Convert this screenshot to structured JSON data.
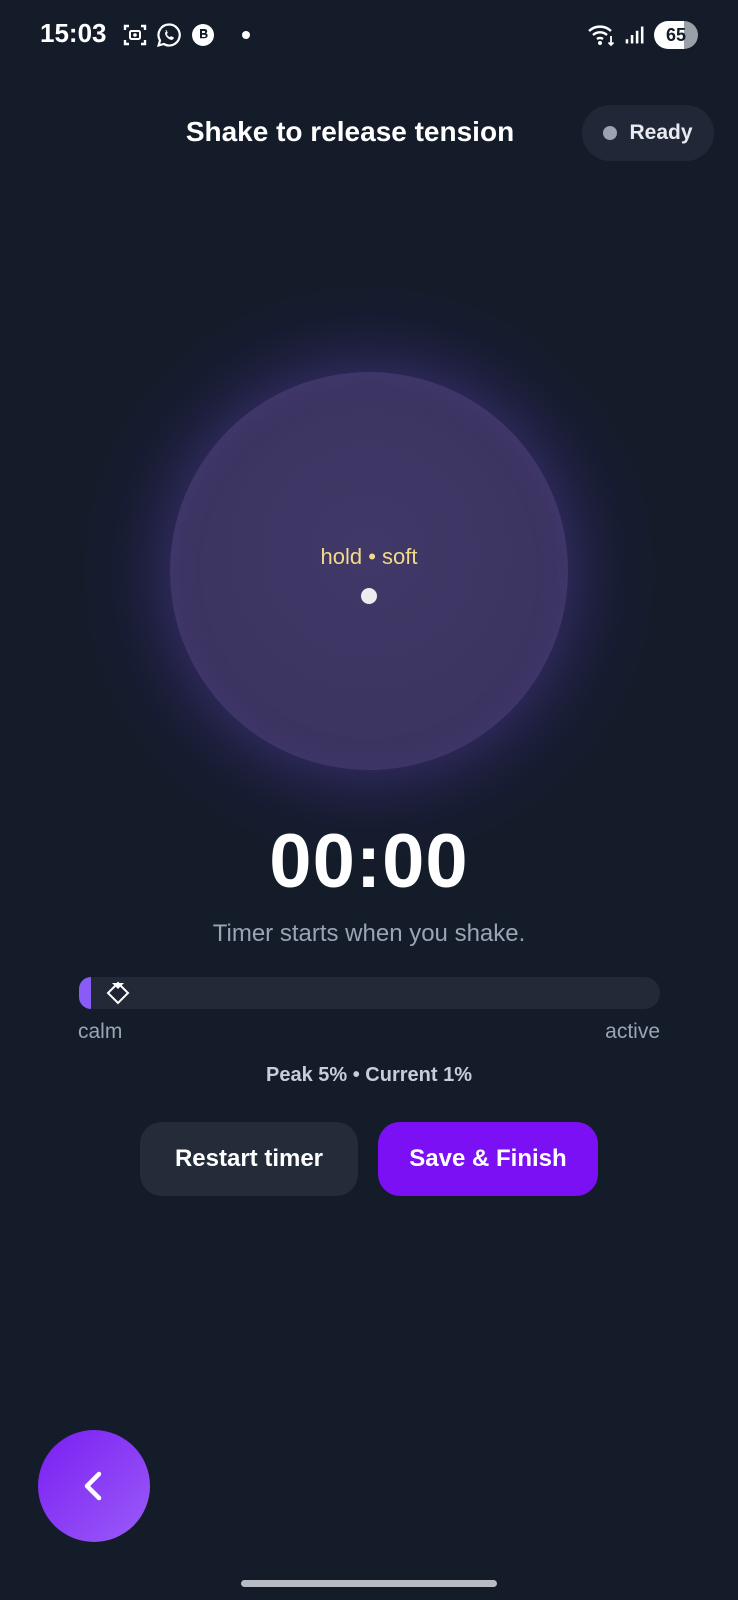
{
  "status_bar": {
    "time": "15:03",
    "battery": "65",
    "left_icons": [
      "screenshot-icon",
      "whatsapp-icon",
      "whatsapp-business-icon",
      "notification-dot"
    ],
    "right_icons": [
      "wifi-icon",
      "signal-icon",
      "battery-icon"
    ]
  },
  "header": {
    "title": "Shake to release tension",
    "status_label": "Ready"
  },
  "orb": {
    "label": "hold • soft"
  },
  "timer": {
    "value": "00:00",
    "hint": "Timer starts when you shake."
  },
  "intensity": {
    "low_label": "calm",
    "high_label": "active",
    "current_fraction": 0.01,
    "peak_fraction": 0.05,
    "readout": "Peak 5% • Current 1%"
  },
  "actions": {
    "restart_label": "Restart timer",
    "save_label": "Save & Finish"
  },
  "navigation": {
    "back_icon": "chevron-left-icon"
  },
  "colors": {
    "background": "#141c2a",
    "accent": "#7c10f5",
    "orb": "#3d3563",
    "orb_label": "#f3d98a"
  }
}
